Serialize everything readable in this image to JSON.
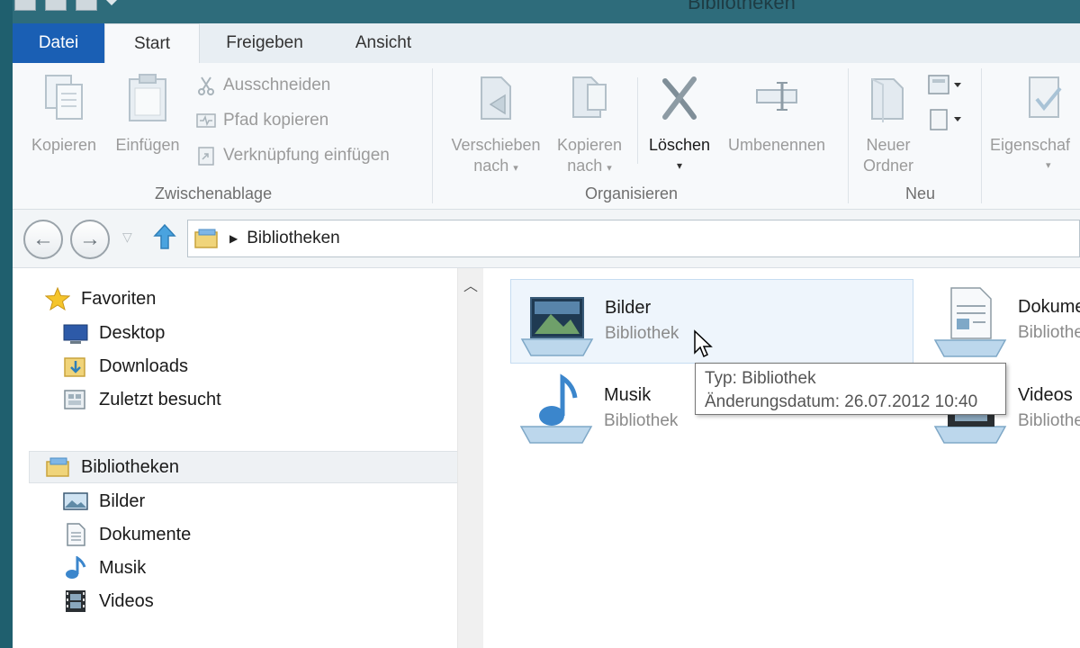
{
  "window": {
    "title": "Bibliotheken"
  },
  "tabs": [
    {
      "label": "Datei"
    },
    {
      "label": "Start"
    },
    {
      "label": "Freigeben"
    },
    {
      "label": "Ansicht"
    }
  ],
  "ribbon": {
    "zwischenablage": {
      "label": "Zwischenablage",
      "kopieren": "Kopieren",
      "einfuegen": "Einfügen",
      "ausschneiden": "Ausschneiden",
      "pfad_kopieren": "Pfad kopieren",
      "verknuepfung": "Verknüpfung einfügen"
    },
    "organisieren": {
      "label": "Organisieren",
      "verschieben_1": "Verschieben",
      "verschieben_2": "nach",
      "kopieren_1": "Kopieren",
      "kopieren_2": "nach",
      "loeschen": "Löschen",
      "umbenennen": "Umbenennen"
    },
    "neu": {
      "label": "Neu",
      "ordner_1": "Neuer",
      "ordner_2": "Ordner"
    },
    "oeffnen": {
      "eigenschaften": "Eigenschaf"
    }
  },
  "navigation": {
    "address_path": "Bibliotheken"
  },
  "sidebar": {
    "favorites_header": "Favoriten",
    "favorites": [
      {
        "label": "Desktop"
      },
      {
        "label": "Downloads"
      },
      {
        "label": "Zuletzt besucht"
      }
    ],
    "libraries_header": "Bibliotheken",
    "libraries": [
      {
        "label": "Bilder"
      },
      {
        "label": "Dokumente"
      },
      {
        "label": "Musik"
      },
      {
        "label": "Videos"
      }
    ]
  },
  "items": [
    {
      "name": "Bilder",
      "type": "Bibliothek"
    },
    {
      "name": "Dokume",
      "type": "Bibliothe"
    },
    {
      "name": "Musik",
      "type": "Bibliothek"
    },
    {
      "name": "Videos",
      "type": "Bibliothe"
    }
  ],
  "tooltip": {
    "line1": "Typ: Bibliothek",
    "line2": "Änderungsdatum: 26.07.2012 10:40"
  },
  "colors": {
    "file_tab": "#1a5fb4",
    "title_bar": "#2e6c7b",
    "hover_tile": "#eef5fc"
  }
}
